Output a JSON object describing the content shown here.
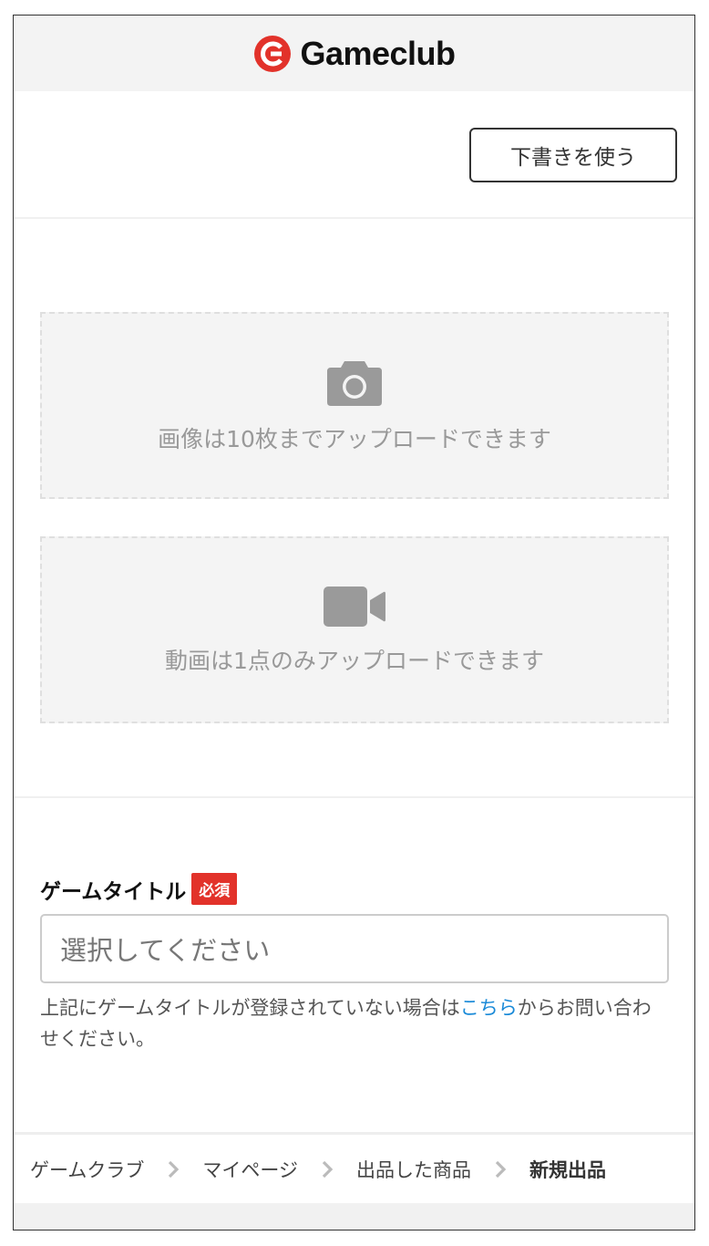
{
  "header": {
    "logo_text": "Gameclub",
    "brand_color": "#e2322a"
  },
  "draft": {
    "button_label": "下書きを使う"
  },
  "uploads": {
    "photo": {
      "icon": "camera-icon",
      "text": "画像は10枚までアップロードできます"
    },
    "video": {
      "icon": "video-camera-icon",
      "text": "動画は1点のみアップロードできます"
    }
  },
  "game_title": {
    "label": "ゲームタイトル",
    "required_badge": "必須",
    "placeholder": "選択してください",
    "help_before": "上記にゲームタイトルが登録されていない場合は",
    "help_link": "こちら",
    "help_after": "からお問い合わせください。",
    "link_color": "#1a8ad8"
  },
  "breadcrumb": {
    "items": [
      {
        "label": "ゲームクラブ"
      },
      {
        "label": "マイページ"
      },
      {
        "label": "出品した商品"
      },
      {
        "label": "新規出品"
      }
    ]
  }
}
